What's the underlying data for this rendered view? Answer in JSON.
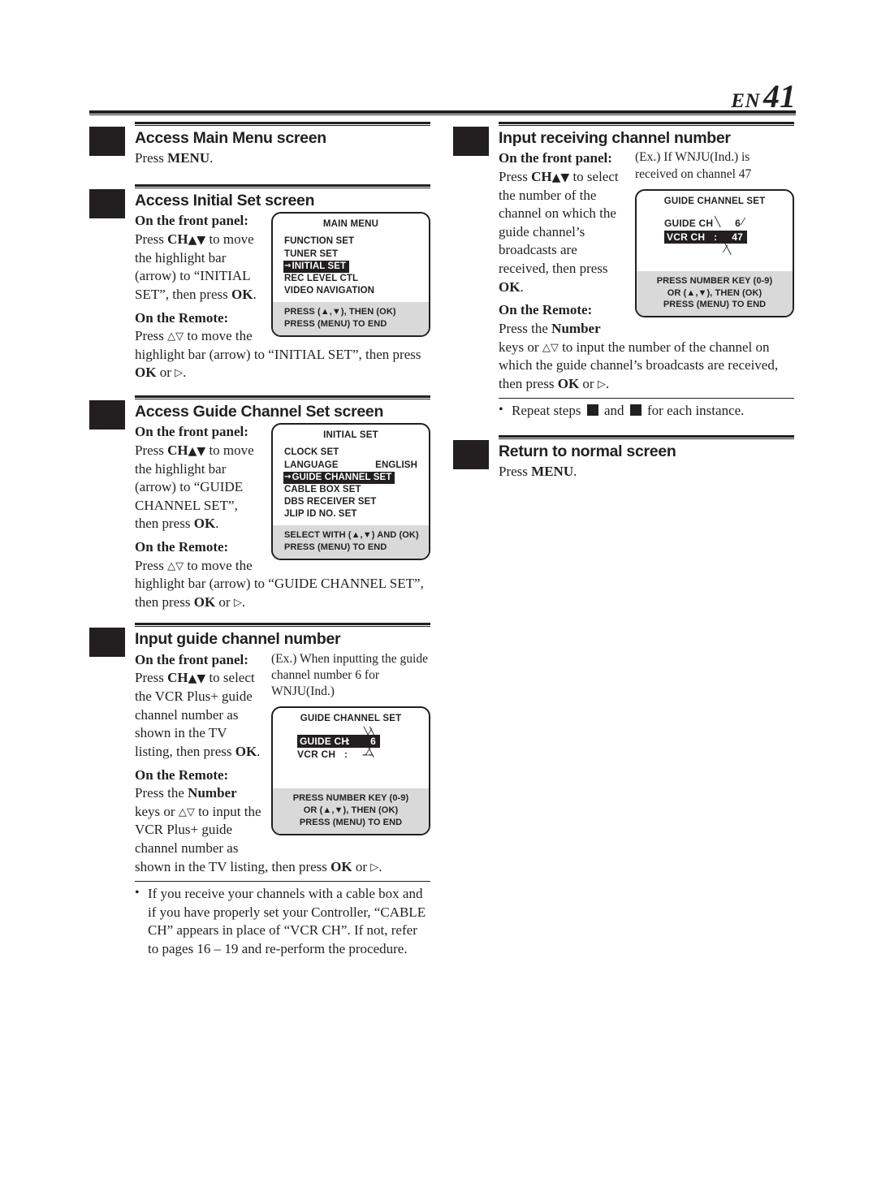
{
  "header": {
    "lang": "EN",
    "page_number": "41"
  },
  "left_column": {
    "steps": [
      {
        "title": "Access Main Menu screen",
        "body_simple": "Press MENU.",
        "body_simple_plain": "Press ",
        "body_simple_bold": "MENU",
        "body_simple_tail": "."
      },
      {
        "title": "Access Initial Set screen",
        "front_panel_label": "On the front panel:",
        "front_panel_text_a": "Press ",
        "front_panel_text_b": "CH",
        "front_panel_text_c": " to move the highlight bar (arrow) to “INITIAL SET”, then press ",
        "front_panel_text_d": "OK",
        "front_panel_text_e": ".",
        "remote_label": "On the Remote:",
        "remote_text_a": "Press ",
        "remote_text_b": " to move the highlight bar (arrow) to “INITIAL SET”, then press ",
        "remote_text_c": "OK",
        "remote_text_d": " or ",
        "remote_text_e": "."
      },
      {
        "title": "Access Guide Channel Set screen",
        "front_panel_label": "On the front panel:",
        "front_panel_text_a": "Press ",
        "front_panel_text_b": "CH",
        "front_panel_text_c": " to move the highlight bar (arrow) to “GUIDE CHANNEL SET”, then press ",
        "front_panel_text_d": "OK",
        "front_panel_text_e": ".",
        "remote_label": "On the Remote:",
        "remote_text_a": "Press ",
        "remote_text_b": " to move the highlight bar (arrow) to “GUIDE CHANNEL SET”, then press ",
        "remote_text_c": "OK",
        "remote_text_d": " or ",
        "remote_text_e": "."
      },
      {
        "title": "Input guide channel number",
        "front_panel_label": "On the front panel:",
        "front_panel_text_a": "Press ",
        "front_panel_text_b": "CH",
        "front_panel_text_c": " to select the VCR Plus+ guide channel number as shown in the TV listing, then press ",
        "front_panel_text_d": "OK",
        "front_panel_text_e": ".",
        "remote_label": "On the Remote:",
        "remote_text_a": "Press the ",
        "remote_text_b": "Number",
        "remote_text_c": " keys or ",
        "remote_text_d": " to input the VCR Plus+ guide channel number as shown in the TV listing, then press ",
        "remote_text_e": "OK",
        "remote_text_f": " or ",
        "remote_text_g": "."
      }
    ],
    "example_note": "(Ex.) When inputting the guide channel number 6 for WNJU(Ind.)",
    "cable_note": "If you receive your channels with a cable box and if you have properly set your Controller, “CABLE CH” appears in place of “VCR CH”. If not, refer to pages 16 – 19 and re-perform the procedure."
  },
  "right_column": {
    "steps": [
      {
        "title": "Input receiving channel number",
        "front_panel_label": "On the front panel:",
        "front_panel_text_a": "Press ",
        "front_panel_text_b": "CH",
        "front_panel_text_c": " to select the number of the channel on which the guide channel’s broadcasts are received, then press ",
        "front_panel_text_d": "OK",
        "front_panel_text_e": ".",
        "remote_label": "On the Remote:",
        "remote_text_a": "Press the ",
        "remote_text_b": "Number",
        "remote_text_c": " keys or ",
        "remote_text_d": " to input the number of the channel on which the guide channel’s broadcasts are received, then press ",
        "remote_text_e": "OK",
        "remote_text_f": " or ",
        "remote_text_g": "."
      },
      {
        "title": "Return to normal screen",
        "body_simple_plain": "Press ",
        "body_simple_bold": "MENU",
        "body_simple_tail": "."
      }
    ],
    "example_note": "(Ex.) If WNJU(Ind.) is received on channel 47",
    "repeat_note_a": "Repeat steps ",
    "repeat_note_b": " and ",
    "repeat_note_c": " for each instance."
  },
  "osd_screens": {
    "main_menu": {
      "title": "MAIN MENU",
      "items": [
        {
          "label": "FUNCTION SET",
          "highlighted": false
        },
        {
          "label": "TUNER SET",
          "highlighted": false
        },
        {
          "label": "INITIAL SET",
          "highlighted": true
        },
        {
          "label": "REC LEVEL CTL",
          "highlighted": false
        },
        {
          "label": "VIDEO NAVIGATION",
          "highlighted": false
        }
      ],
      "footer_line1": "PRESS (▲,▼), THEN (OK)",
      "footer_line2": "PRESS (MENU) TO END"
    },
    "initial_set": {
      "title": "INITIAL SET",
      "items": [
        {
          "label": "CLOCK SET",
          "value": "",
          "highlighted": false
        },
        {
          "label": "LANGUAGE",
          "value": "ENGLISH",
          "highlighted": false
        },
        {
          "label": "GUIDE CHANNEL SET",
          "value": "",
          "highlighted": true
        },
        {
          "label": "CABLE BOX SET",
          "value": "",
          "highlighted": false
        },
        {
          "label": "DBS RECEIVER SET",
          "value": "",
          "highlighted": false
        },
        {
          "label": "JLIP ID NO. SET",
          "value": "",
          "highlighted": false
        }
      ],
      "footer_line1": "SELECT WITH (▲,▼) AND (OK)",
      "footer_line2": "PRESS (MENU) TO END"
    },
    "guide_channel_set_guide": {
      "title": "GUIDE CHANNEL SET",
      "rows": [
        {
          "label": "GUIDE CH",
          "colon": ":",
          "value": "6",
          "highlighted": true,
          "blinking": true
        },
        {
          "label": "VCR CH",
          "colon": ":",
          "value": "––",
          "highlighted": false,
          "blinking": false
        }
      ],
      "footer_line1": "PRESS NUMBER KEY (0-9)",
      "footer_line2": "OR (▲,▼),  THEN (OK)",
      "footer_line3": "PRESS (MENU) TO END"
    },
    "guide_channel_set_vcr": {
      "title": "GUIDE CHANNEL SET",
      "rows": [
        {
          "label": "GUIDE CH",
          "colon": "",
          "value": "6",
          "highlighted": false,
          "blinking": true
        },
        {
          "label": "VCR CH",
          "colon": ":",
          "value": "47",
          "highlighted": true,
          "blinking": true
        }
      ],
      "footer_line1": "PRESS NUMBER KEY (0-9)",
      "footer_line2": "OR (▲,▼),  THEN (OK)",
      "footer_line3": "PRESS (MENU) TO END"
    }
  }
}
